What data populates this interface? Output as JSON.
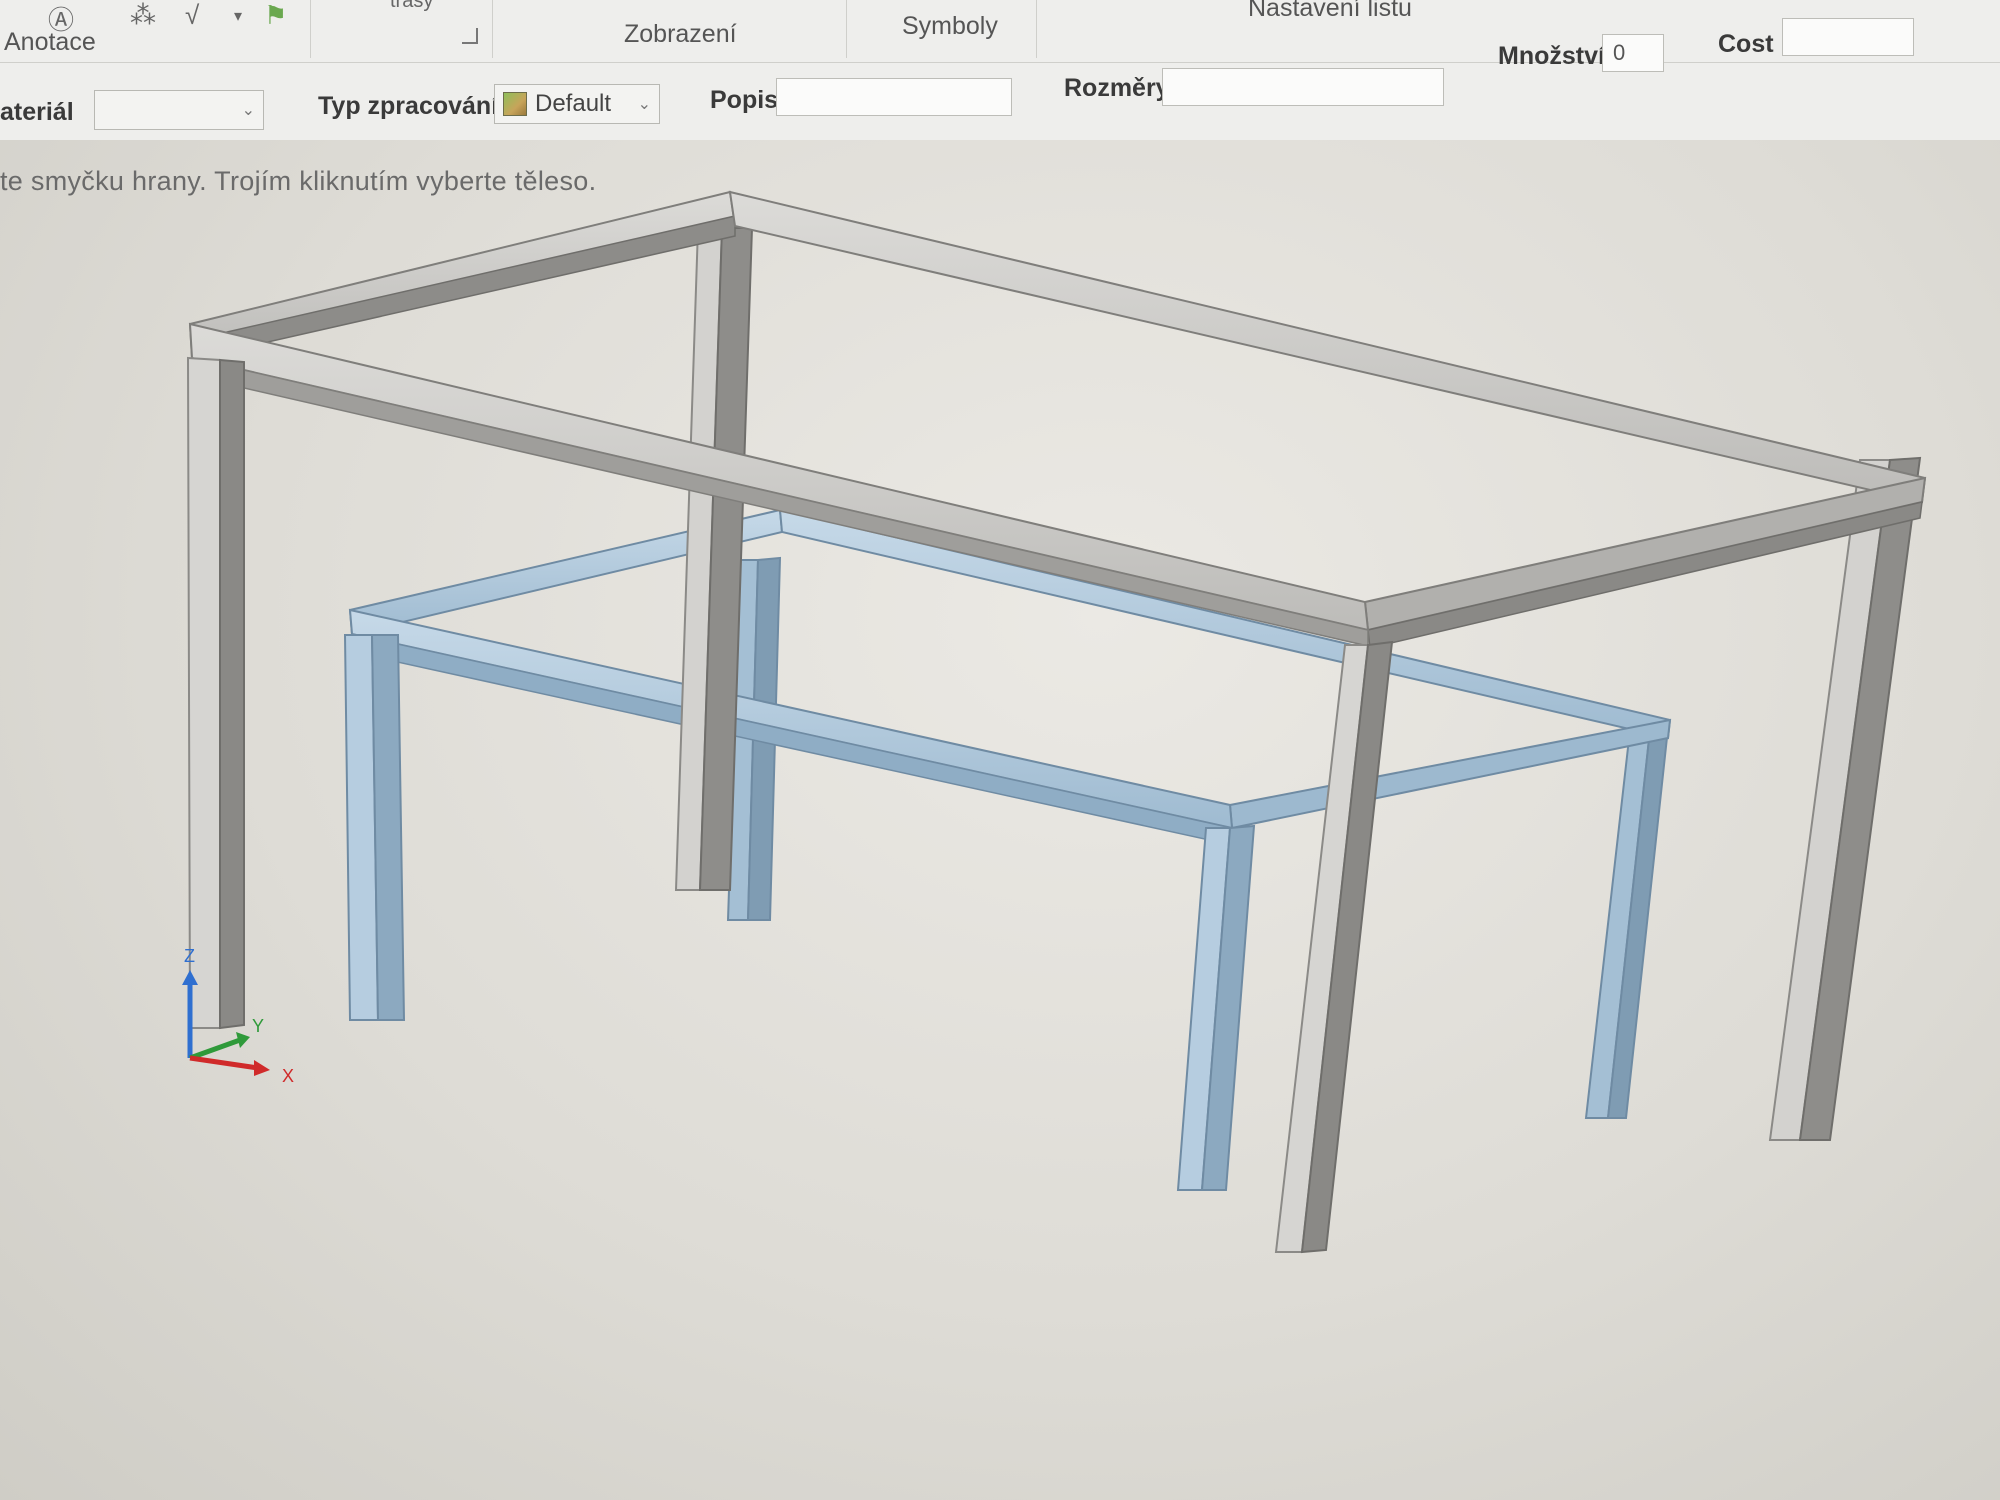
{
  "ribbon": {
    "groups": [
      "Anotace",
      "Zobrazení",
      "Symboly",
      "Nastavení listu"
    ],
    "trasy_label": "trasy"
  },
  "properties": {
    "material_label": "ateriál",
    "material_value": "",
    "processing_label": "Typ zpracování",
    "processing_value": "Default",
    "description_label": "Popis",
    "description_value": "",
    "dimensions_label": "Rozměry",
    "dimensions_value": "",
    "quantity_label": "Množství",
    "quantity_value": "0",
    "cost_label": "Cost",
    "cost_value": ""
  },
  "viewport": {
    "hint": "te smyčku hrany. Trojím kliknutím vyberte těleso.",
    "axes": {
      "x": "X",
      "y": "Y",
      "z": "Z"
    },
    "colors": {
      "gray_frame": "#c9c8c5",
      "blue_frame": "#a9c3d8",
      "x_axis": "#d02a2a",
      "y_axis": "#2f9a3a",
      "z_axis": "#2f6fd0"
    }
  }
}
